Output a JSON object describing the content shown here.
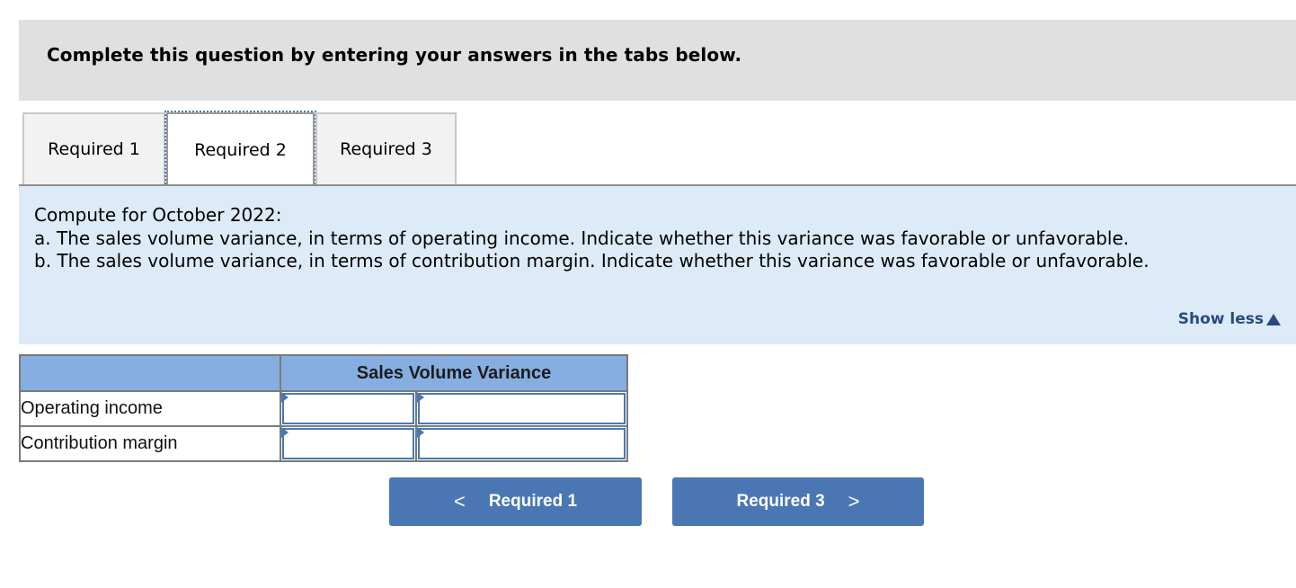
{
  "header": {
    "instruction": "Complete this question by entering your answers in the tabs below."
  },
  "tabs": [
    {
      "label": "Required 1",
      "active": false
    },
    {
      "label": "Required 2",
      "active": true
    },
    {
      "label": "Required 3",
      "active": false
    }
  ],
  "instructions": {
    "lines": [
      "Compute for October 2022:",
      "a. The sales volume variance, in terms of operating income. Indicate whether this variance was favorable or unfavorable.",
      "b. The sales volume variance, in terms of contribution margin. Indicate whether this variance was favorable or unfavorable."
    ],
    "toggle_label": "Show less"
  },
  "table": {
    "header": "Sales Volume Variance",
    "rows": [
      {
        "label": "Operating income",
        "amount": "",
        "type": ""
      },
      {
        "label": "Contribution margin",
        "amount": "",
        "type": ""
      }
    ]
  },
  "nav": {
    "prev_label": "Required 1",
    "next_label": "Required 3",
    "prev_icon": "<",
    "next_icon": ">"
  },
  "colors": {
    "accent": "#4a77b4",
    "table_header": "#86aee0",
    "instruction_bg": "#ddeaf7",
    "link": "#284a80"
  }
}
